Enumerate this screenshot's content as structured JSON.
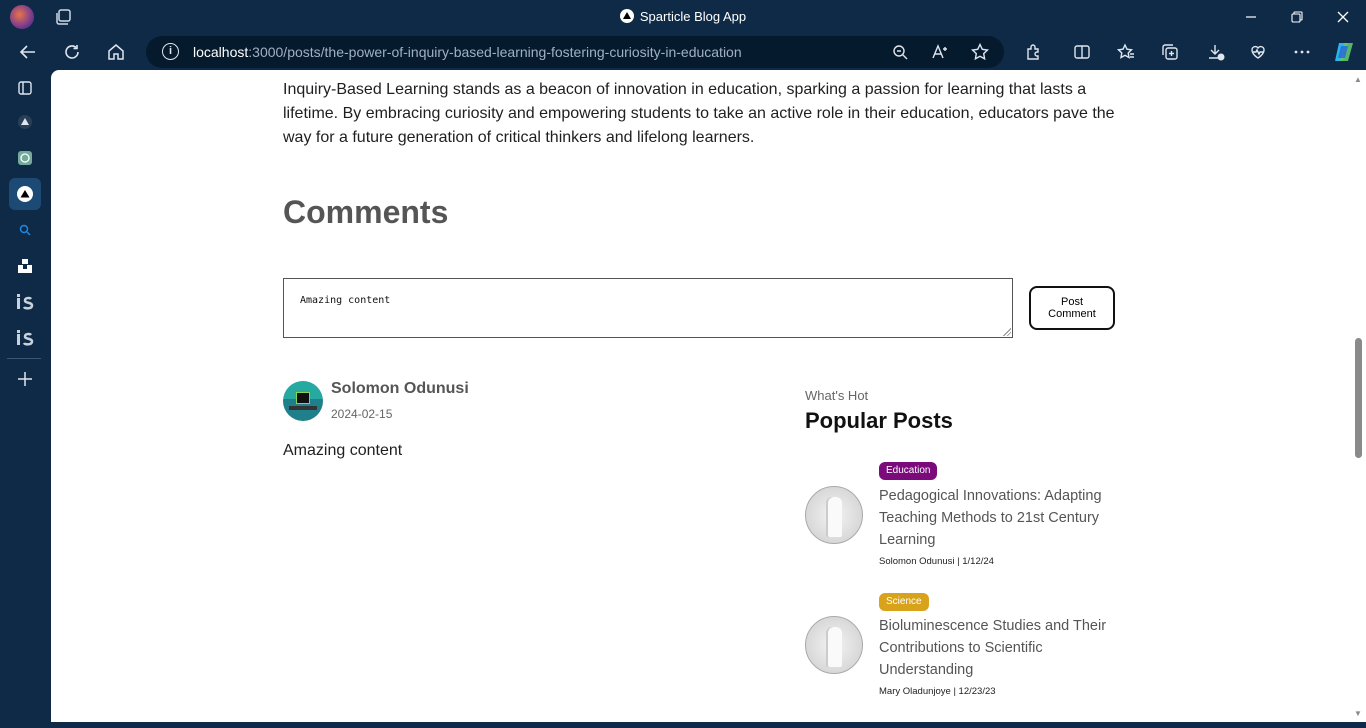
{
  "browser": {
    "window_title": "Sparticle Blog App",
    "url_host": "localhost",
    "url_path": ":3000/posts/the-power-of-inquiry-based-learning-fostering-curiosity-in-education"
  },
  "article": {
    "closing_paragraph": "Inquiry-Based Learning stands as a beacon of innovation in education, sparking a passion for learning that lasts a lifetime. By embracing curiosity and empowering students to take an active role in their education, educators pave the way for a future generation of critical thinkers and lifelong learners."
  },
  "comments": {
    "heading": "Comments",
    "input_value": "Amazing content",
    "post_button_label": "Post Comment",
    "items": [
      {
        "author": "Solomon Odunusi",
        "date": "2024-02-15",
        "text": "Amazing content"
      }
    ]
  },
  "popular": {
    "kicker": "What's Hot",
    "heading": "Popular Posts",
    "posts": [
      {
        "category": "Education",
        "category_color": "#7b0a7b",
        "title": "Pedagogical Innovations: Adapting Teaching Methods to 21st Century Learning",
        "meta": "Solomon Odunusi | 1/12/24"
      },
      {
        "category": "Science",
        "category_color": "#d9a21b",
        "title": "Bioluminescence Studies and Their Contributions to Scientific Understanding",
        "meta": "Mary Oladunjoye | 12/23/23"
      }
    ]
  },
  "sidebar_icons": [
    "tab-actions-icon",
    "vercel-icon",
    "chatgpt-icon",
    "vercel-active-icon",
    "search-icon",
    "unsplash-icon",
    "is-icon",
    "is-icon",
    "add-icon"
  ],
  "colors": {
    "chrome_bg": "#0e2a47",
    "address_bg": "#061a2e"
  }
}
